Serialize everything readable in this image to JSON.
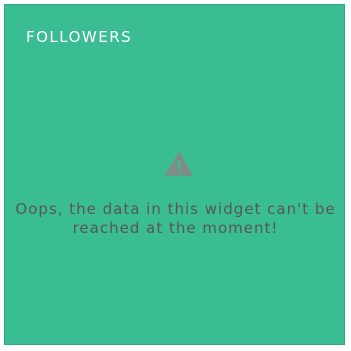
{
  "widget": {
    "title": "FOLLOWERS",
    "icon": "warning-icon",
    "message": "Oops, the data in this widget can't be reached at the moment!",
    "background_color": "#3bbd93",
    "icon_color": "#7f8c88",
    "text_color": "#565656"
  }
}
